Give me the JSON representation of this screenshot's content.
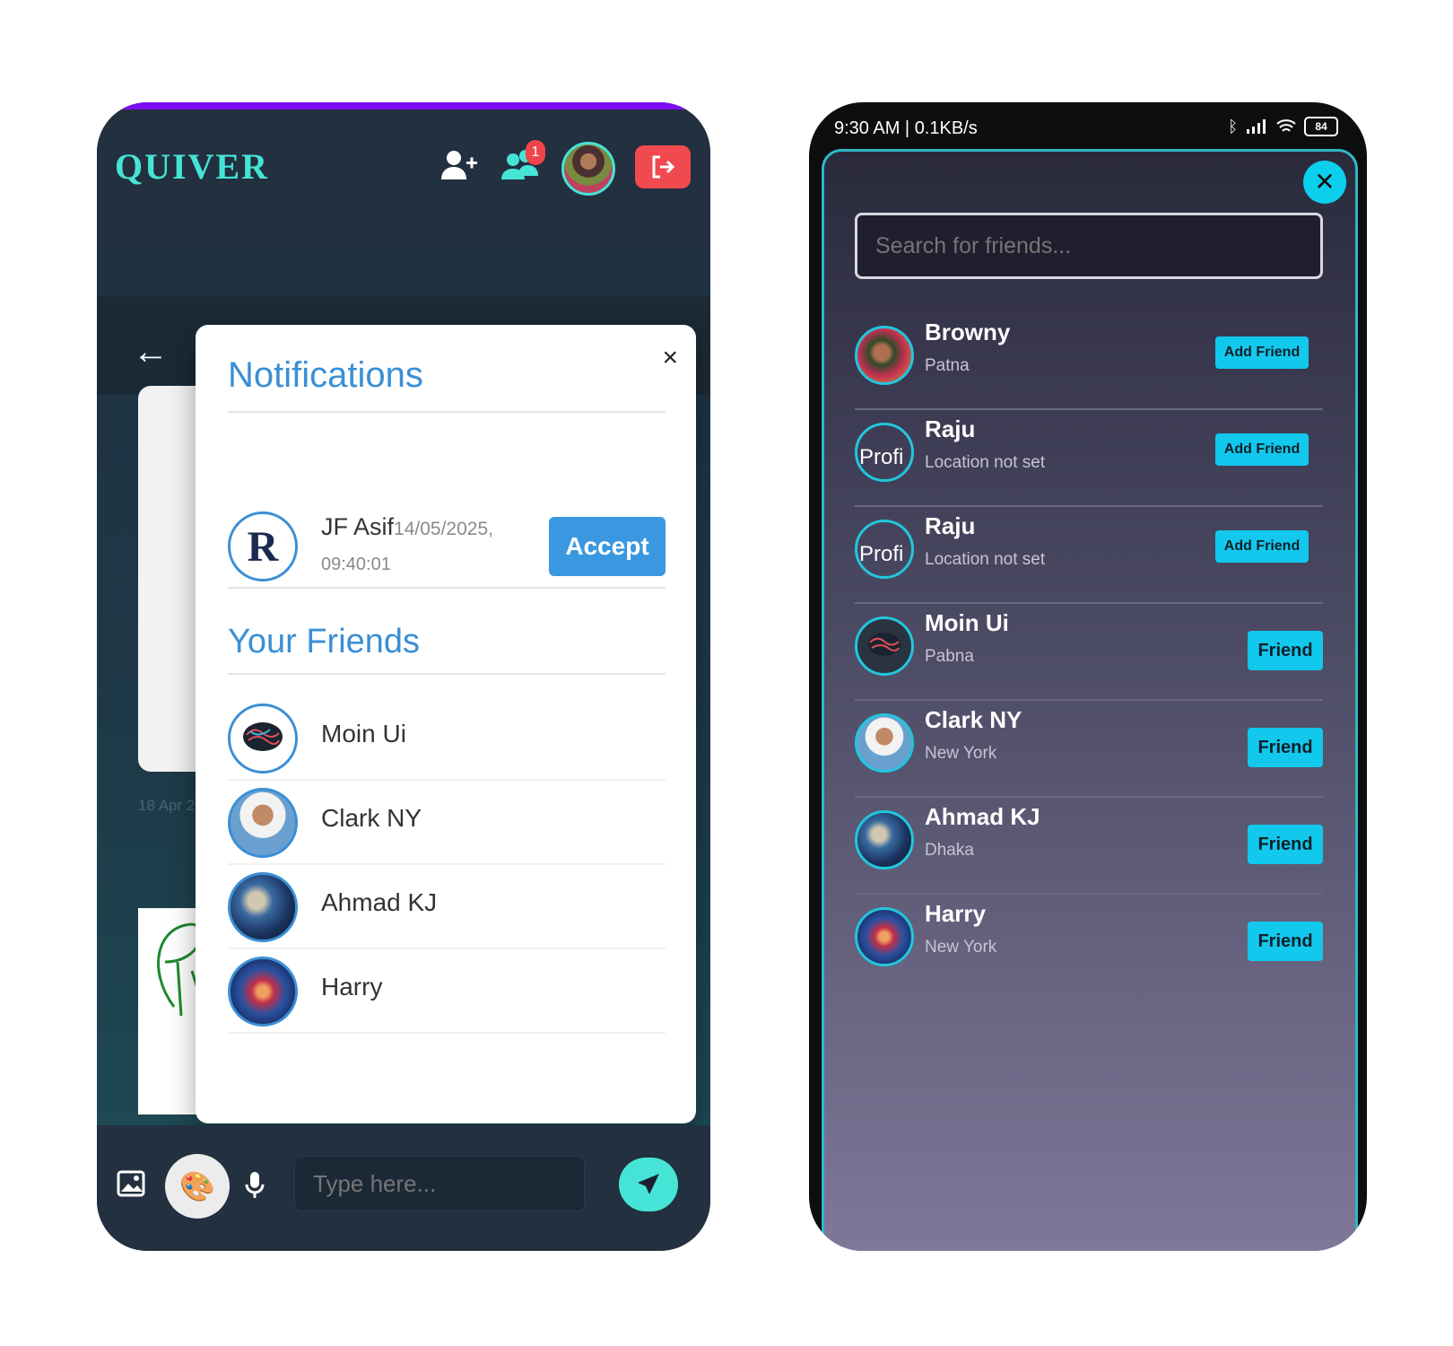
{
  "left": {
    "logo": "QUIVER",
    "notif_badge": "1",
    "bg_date": "18 Apr 2",
    "notifications": {
      "title": "Notifications",
      "close": "×",
      "request": {
        "name": "JF Asif",
        "date": "14/05/2025,",
        "time": "09:40:01",
        "accept": "Accept"
      },
      "friends_title": "Your Friends",
      "friends": [
        {
          "name": "Moin Ui"
        },
        {
          "name": "Clark NY"
        },
        {
          "name": "Ahmad KJ"
        },
        {
          "name": "Harry"
        }
      ]
    },
    "composer": {
      "placeholder": "Type here..."
    }
  },
  "right": {
    "status": {
      "left": "9:30 AM | 0.1KB/s",
      "battery": "84"
    },
    "search": {
      "placeholder": "Search for friends..."
    },
    "close": "✕",
    "users": [
      {
        "name": "Browny",
        "location": "Patna",
        "action": "Add Friend"
      },
      {
        "name": "Raju",
        "location": "Location not set",
        "action": "Add Friend",
        "broken": "Profi"
      },
      {
        "name": "Raju",
        "location": "Location not set",
        "action": "Add Friend",
        "broken": "Profi"
      },
      {
        "name": "Moin Ui",
        "location": "Pabna",
        "action": "Friend"
      },
      {
        "name": "Clark NY",
        "location": "New York",
        "action": "Friend"
      },
      {
        "name": "Ahmad KJ",
        "location": "Dhaka",
        "action": "Friend"
      },
      {
        "name": "Harry",
        "location": "New York",
        "action": "Friend"
      }
    ]
  },
  "colors": {
    "accent": "#46e4d6",
    "blue": "#3a8fd6",
    "cyan_button": "#12c8ec",
    "logout_red": "#f04a50"
  }
}
